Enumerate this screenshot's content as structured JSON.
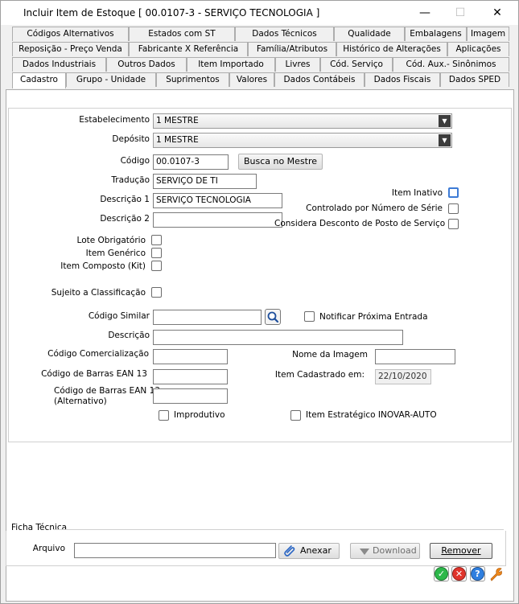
{
  "window": {
    "title": "Incluir Item de Estoque [ 00.0107-3 - SERVIÇO TECNOLOGIA ]",
    "minimize_glyph": "—",
    "maximize_glyph": "☐",
    "close_glyph": "✕"
  },
  "tabs": {
    "row1": [
      "Códigos Alternativos",
      "Estados com ST",
      "Dados Técnicos",
      "Qualidade",
      "Embalagens",
      "Imagem"
    ],
    "row2": [
      "Reposição - Preço Venda",
      "Fabricante X Referência",
      "Família/Atributos",
      "Histórico de Alterações",
      "Aplicações"
    ],
    "row3": [
      "Dados Industriais",
      "Outros Dados",
      "Item Importado",
      "Livres",
      "Cód. Serviço",
      "Cód. Aux.- Sinônimos"
    ],
    "row4": [
      "Cadastro",
      "Grupo - Unidade",
      "Suprimentos",
      "Valores",
      "Dados Contábeis",
      "Dados Fiscais",
      "Dados SPED"
    ],
    "active": "Cadastro"
  },
  "form": {
    "estabelecimento_label": "Estabelecimento",
    "estabelecimento_value": "1 MESTRE",
    "deposito_label": "Depósito",
    "deposito_value": "1 MESTRE",
    "codigo_label": "Código",
    "codigo_value": "00.0107-3",
    "busca_button": "Busca no Mestre",
    "traducao_label": "Tradução",
    "traducao_value": "SERVIÇO DE TI",
    "descricao1_label": "Descrição 1",
    "descricao1_value": "SERVIÇO TECNOLOGIA",
    "descricao2_label": "Descrição 2",
    "descricao2_value": "",
    "item_inativo_label": "Item Inativo",
    "controlado_label": "Controlado por Número de Série",
    "considera_label": "Considera Desconto de Posto de Serviço",
    "lote_label": "Lote Obrigatório",
    "item_generico_label": "Item Genérico",
    "item_composto_label": "Item Composto (Kit)",
    "sujeito_label": "Sujeito a Classificação",
    "codigo_similar_label": "Código Similar",
    "codigo_similar_value": "",
    "notificar_label": "Notificar Próxima Entrada",
    "descricao_label": "Descrição",
    "descricao_value": "",
    "codigo_comerc_label": "Código Comercialização",
    "codigo_comerc_value": "",
    "nome_imagem_label": "Nome da Imagem",
    "nome_imagem_value": "",
    "ean13_label": "Código de Barras EAN 13",
    "ean13_value": "",
    "item_cadastrado_label": "Item Cadastrado em:",
    "item_cadastrado_value": "22/10/2020",
    "ean13_alt_label_1": "Código de Barras EAN 13",
    "ean13_alt_label_2": "(Alternativo)",
    "ean13_alt_value": "",
    "improdutivo_label": "Improdutivo",
    "inovar_label": "Item Estratégico INOVAR-AUTO"
  },
  "ficha": {
    "title": "Ficha Técnica",
    "arquivo_label": "Arquivo",
    "arquivo_value": "",
    "anexar_button": "Anexar",
    "download_button": "Download",
    "remover_button": "Remover"
  },
  "actions": {
    "ok_glyph": "✓",
    "cancel_glyph": "✕",
    "help_glyph": "?",
    "tools_glyph": "🔧"
  },
  "colors": {
    "ok": "#2db84a",
    "cancel": "#e0342b",
    "help": "#2f7fe0",
    "tools": "#f08a1c"
  }
}
